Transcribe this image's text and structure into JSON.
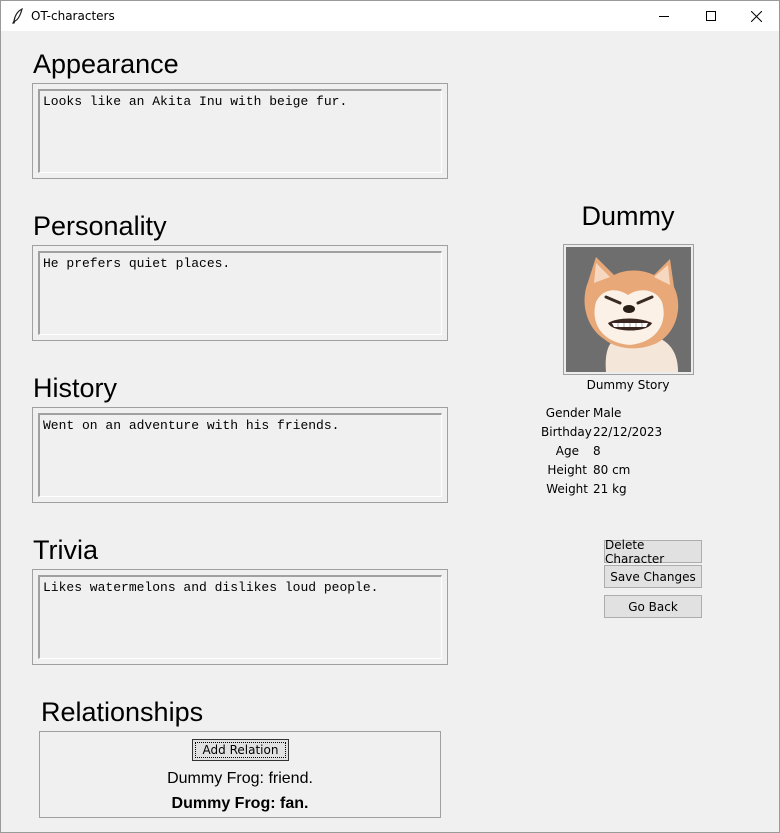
{
  "window": {
    "title": "OT-characters"
  },
  "sections": {
    "appearance": {
      "title": "Appearance",
      "text": "Looks like an Akita Inu with beige fur."
    },
    "personality": {
      "title": "Personality",
      "text": "He prefers quiet places."
    },
    "history": {
      "title": "History",
      "text": "Went on an adventure with his friends."
    },
    "trivia": {
      "title": "Trivia",
      "text": "Likes watermelons and dislikes loud people."
    }
  },
  "character": {
    "name": "Dummy",
    "story": "Dummy Story",
    "info": [
      {
        "label": "Gender",
        "value": "Male"
      },
      {
        "label": "Birthday",
        "value": "22/12/2023"
      },
      {
        "label": "Age",
        "value": "8"
      },
      {
        "label": "Height",
        "value": "80 cm"
      },
      {
        "label": "Weight",
        "value": "21 kg"
      }
    ]
  },
  "actions": {
    "delete_label": "Delete Character",
    "save_label": "Save Changes",
    "back_label": "Go Back"
  },
  "relationships": {
    "title": "Relationships",
    "add_label": "Add Relation",
    "items": [
      "Dummy Frog: friend.",
      "Dummy Frog: fan."
    ]
  }
}
